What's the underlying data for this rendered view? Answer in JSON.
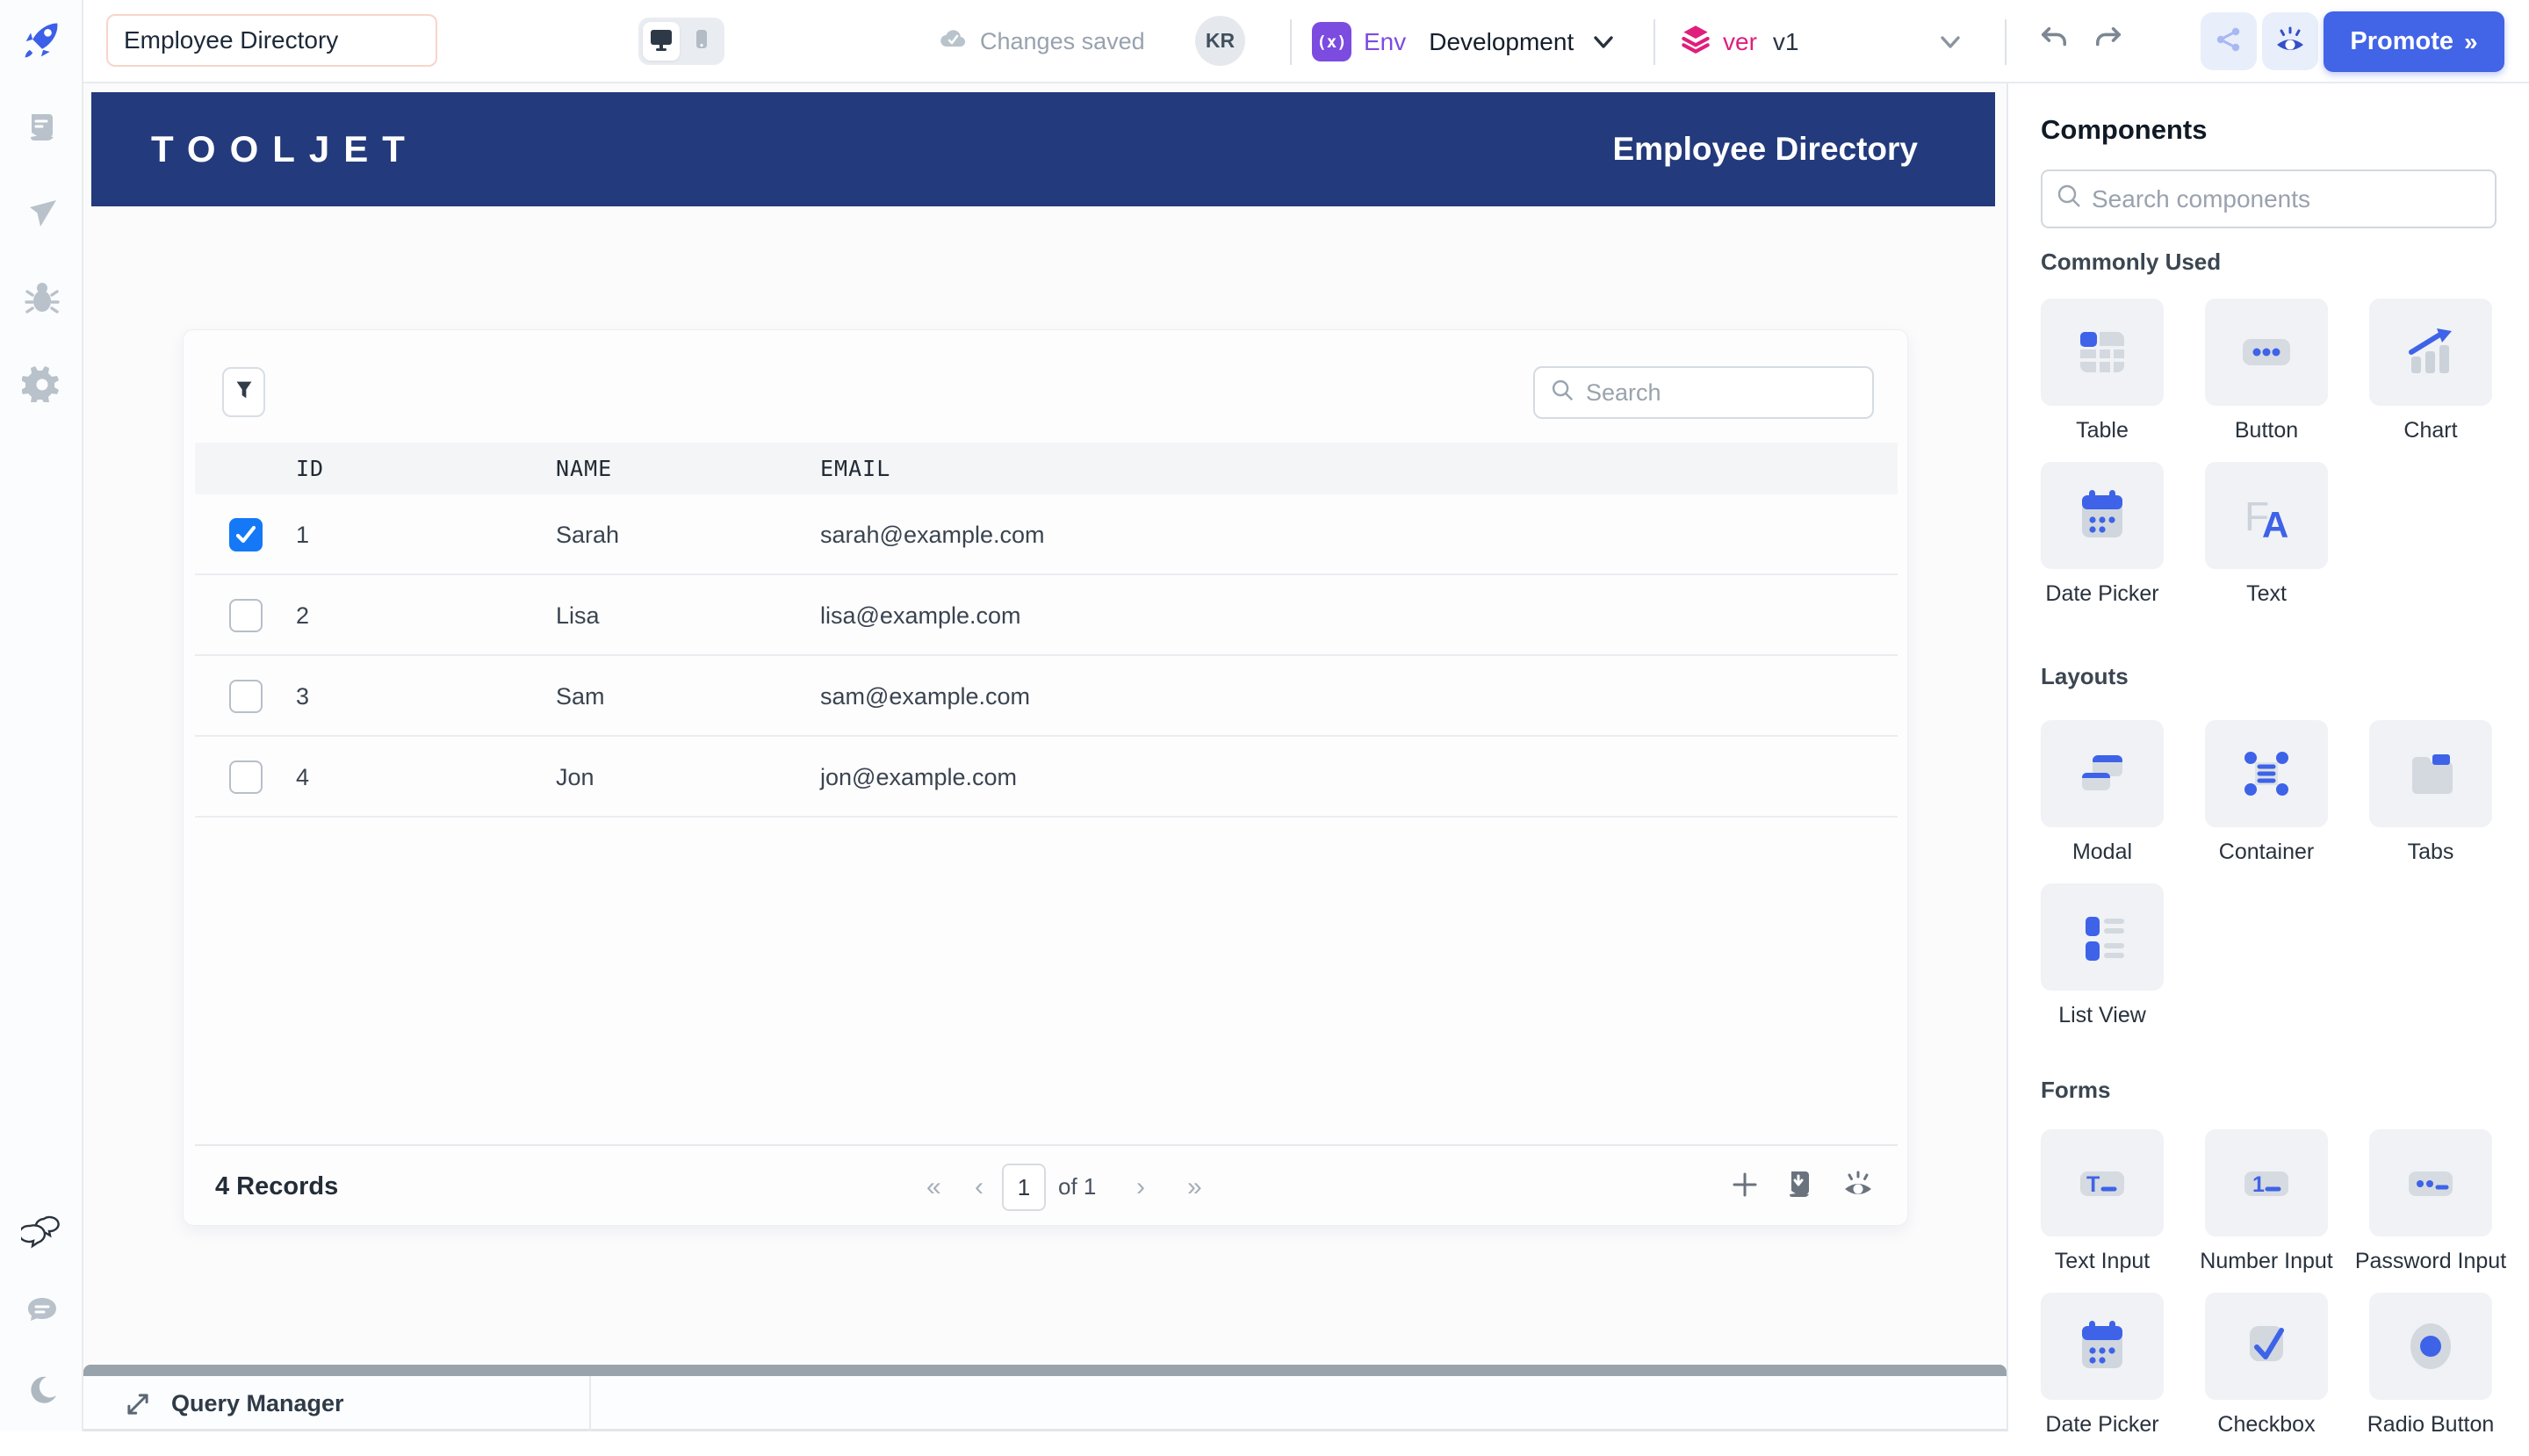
{
  "topbar": {
    "app_name": "Employee Directory",
    "status_text": "Changes saved",
    "avatar_initials": "KR",
    "env_label": "Env",
    "env_value": "Development",
    "version_label": "ver",
    "version_value": "v1",
    "promote_label": "Promote",
    "promote_chevrons": "»"
  },
  "canvas": {
    "header": {
      "brand": "TOOLJET",
      "title": "Employee Directory"
    },
    "table": {
      "search_placeholder": "Search",
      "columns": [
        "ID",
        "NAME",
        "EMAIL"
      ],
      "rows": [
        {
          "checked": true,
          "id": "1",
          "name": "Sarah",
          "email": "sarah@example.com"
        },
        {
          "checked": false,
          "id": "2",
          "name": "Lisa",
          "email": "lisa@example.com"
        },
        {
          "checked": false,
          "id": "3",
          "name": "Sam",
          "email": "sam@example.com"
        },
        {
          "checked": false,
          "id": "4",
          "name": "Jon",
          "email": "jon@example.com"
        }
      ],
      "records_label": "4 Records",
      "pagination": {
        "first": "«",
        "prev": "‹",
        "page": "1",
        "of": "of 1",
        "next": "›",
        "last": "»"
      }
    }
  },
  "query_panel": {
    "title": "Query Manager"
  },
  "components_panel": {
    "title": "Components",
    "search_placeholder": "Search components",
    "sections": [
      {
        "label": "Commonly Used",
        "items": [
          {
            "label": "Table",
            "icon": "table"
          },
          {
            "label": "Button",
            "icon": "button"
          },
          {
            "label": "Chart",
            "icon": "chart"
          },
          {
            "label": "Date Picker",
            "icon": "datepicker"
          },
          {
            "label": "Text",
            "icon": "text"
          }
        ]
      },
      {
        "label": "Layouts",
        "items": [
          {
            "label": "Modal",
            "icon": "modal"
          },
          {
            "label": "Container",
            "icon": "container"
          },
          {
            "label": "Tabs",
            "icon": "tabs"
          },
          {
            "label": "List View",
            "icon": "listview"
          }
        ]
      },
      {
        "label": "Forms",
        "items": [
          {
            "label": "Text Input",
            "icon": "textinput"
          },
          {
            "label": "Number Input",
            "icon": "numberinput"
          },
          {
            "label": "Password Input",
            "icon": "passwordinput"
          },
          {
            "label": "Date Picker",
            "icon": "datepicker"
          },
          {
            "label": "Checkbox",
            "icon": "checkbox"
          },
          {
            "label": "Radio Button",
            "icon": "radio"
          }
        ]
      }
    ]
  },
  "colors": {
    "accent_blue": "#3e63e8",
    "navy_header": "#233a7c",
    "env_purple": "#7c4be0",
    "version_pink": "#e01e7c",
    "checkbox_blue": "#1478f7",
    "promote_blue": "#4264e6"
  }
}
